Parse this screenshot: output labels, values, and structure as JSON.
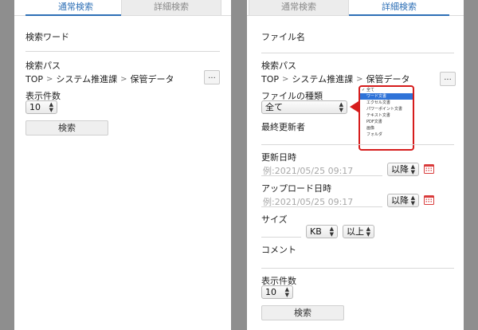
{
  "left": {
    "tabs": {
      "normal": "通常検索",
      "detail": "詳細検索"
    },
    "keyword_label": "検索ワード",
    "search_path_label": "検索パス",
    "path": [
      "TOP",
      "システム推進課",
      "保管データ"
    ],
    "path_sep": ">",
    "browse_button": "...",
    "count_label": "表示件数",
    "count_value": "10",
    "search_button": "検索"
  },
  "right": {
    "tabs": {
      "normal": "通常検索",
      "detail": "詳細検索"
    },
    "filename_label": "ファイル名",
    "search_path_label": "検索パス",
    "path": [
      "TOP",
      "システム推進課",
      "保管データ"
    ],
    "path_sep": ">",
    "browse_button": "...",
    "file_type_label": "ファイルの種類",
    "file_type_value": "全て",
    "last_updater_label": "最終更新者",
    "updated_label": "更新日時",
    "updated_placeholder": "例:2021/05/25 09:17",
    "updated_op": "以降",
    "upload_label": "アップロード日時",
    "upload_placeholder": "例:2021/05/25 09:17",
    "upload_op": "以降",
    "size_label": "サイズ",
    "size_unit": "KB",
    "size_op": "以上",
    "comment_label": "コメント",
    "count_label": "表示件数",
    "count_value": "10",
    "search_button": "検索",
    "dropdown_items": [
      "全て",
      "ワード文書",
      "エクセル文書",
      "パワーポイント文書",
      "テキスト文書",
      "PDF文書",
      "画像",
      "フォルダ"
    ],
    "dropdown_checkmark": "✓"
  },
  "colors": {
    "accent": "#2d6fb6",
    "highlight": "#d61c1c",
    "selection": "#2f73d8",
    "calendar": "#d93a3a"
  }
}
